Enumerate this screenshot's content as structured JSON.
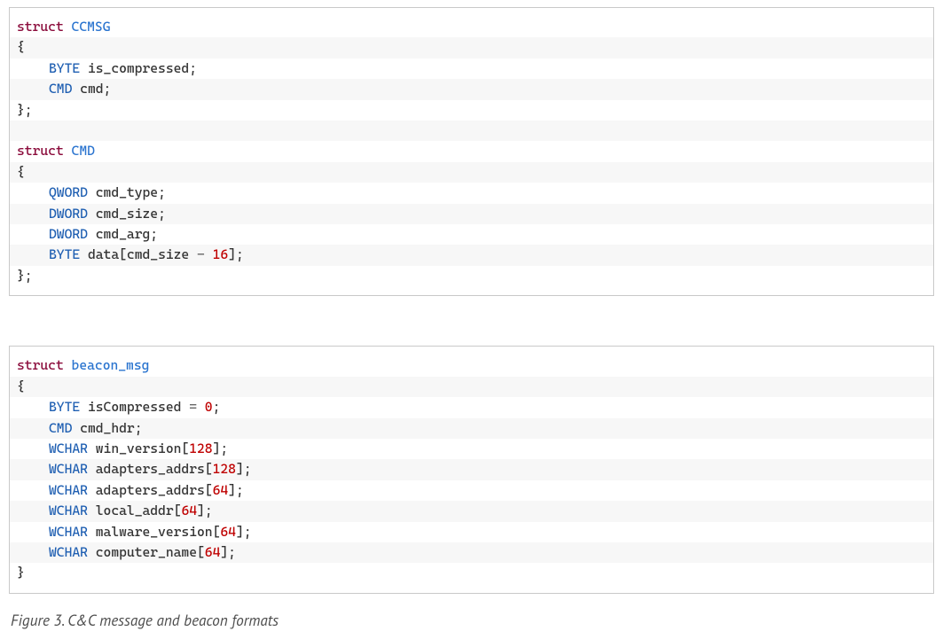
{
  "code1": {
    "lines": [
      {
        "stripe": false,
        "tokens": [
          {
            "cls": "kw",
            "t": "struct"
          },
          {
            "cls": "name",
            "t": " "
          },
          {
            "cls": "ident",
            "t": "CCMSG"
          }
        ]
      },
      {
        "stripe": true,
        "tokens": [
          {
            "cls": "punct",
            "t": "{"
          }
        ]
      },
      {
        "stripe": false,
        "indent": true,
        "tokens": [
          {
            "cls": "type",
            "t": "BYTE"
          },
          {
            "cls": "name",
            "t": " is_compressed"
          },
          {
            "cls": "punct",
            "t": ";"
          }
        ]
      },
      {
        "stripe": true,
        "indent": true,
        "tokens": [
          {
            "cls": "type",
            "t": "CMD"
          },
          {
            "cls": "name",
            "t": " cmd"
          },
          {
            "cls": "punct",
            "t": ";"
          }
        ]
      },
      {
        "stripe": false,
        "tokens": [
          {
            "cls": "punct",
            "t": "};"
          }
        ]
      },
      {
        "stripe": true,
        "tokens": [
          {
            "cls": "name",
            "t": " "
          }
        ]
      },
      {
        "stripe": false,
        "tokens": [
          {
            "cls": "kw",
            "t": "struct"
          },
          {
            "cls": "name",
            "t": " "
          },
          {
            "cls": "ident",
            "t": "CMD"
          }
        ]
      },
      {
        "stripe": true,
        "tokens": [
          {
            "cls": "punct",
            "t": "{"
          }
        ]
      },
      {
        "stripe": false,
        "indent": true,
        "tokens": [
          {
            "cls": "type",
            "t": "QWORD"
          },
          {
            "cls": "name",
            "t": " cmd_type"
          },
          {
            "cls": "punct",
            "t": ";"
          }
        ]
      },
      {
        "stripe": true,
        "indent": true,
        "tokens": [
          {
            "cls": "type",
            "t": "DWORD"
          },
          {
            "cls": "name",
            "t": " cmd_size"
          },
          {
            "cls": "punct",
            "t": ";"
          }
        ]
      },
      {
        "stripe": false,
        "indent": true,
        "tokens": [
          {
            "cls": "type",
            "t": "DWORD"
          },
          {
            "cls": "name",
            "t": " cmd_arg"
          },
          {
            "cls": "punct",
            "t": ";"
          }
        ]
      },
      {
        "stripe": true,
        "indent": true,
        "tokens": [
          {
            "cls": "type",
            "t": "BYTE"
          },
          {
            "cls": "name",
            "t": " data"
          },
          {
            "cls": "punct",
            "t": "["
          },
          {
            "cls": "name",
            "t": "cmd_size "
          },
          {
            "cls": "op",
            "t": "-"
          },
          {
            "cls": "name",
            "t": " "
          },
          {
            "cls": "num",
            "t": "16"
          },
          {
            "cls": "punct",
            "t": "]"
          },
          {
            "cls": "punct",
            "t": ";"
          }
        ]
      },
      {
        "stripe": false,
        "tokens": [
          {
            "cls": "punct",
            "t": "};"
          }
        ]
      }
    ]
  },
  "code2": {
    "lines": [
      {
        "stripe": false,
        "tokens": [
          {
            "cls": "kw",
            "t": "struct"
          },
          {
            "cls": "name",
            "t": " "
          },
          {
            "cls": "ident",
            "t": "beacon_msg"
          }
        ]
      },
      {
        "stripe": true,
        "tokens": [
          {
            "cls": "punct",
            "t": "{"
          }
        ]
      },
      {
        "stripe": false,
        "indent": true,
        "tokens": [
          {
            "cls": "type",
            "t": "BYTE"
          },
          {
            "cls": "name",
            "t": " isCompressed "
          },
          {
            "cls": "op",
            "t": "="
          },
          {
            "cls": "name",
            "t": " "
          },
          {
            "cls": "num",
            "t": "0"
          },
          {
            "cls": "punct",
            "t": ";"
          }
        ]
      },
      {
        "stripe": true,
        "indent": true,
        "tokens": [
          {
            "cls": "type",
            "t": "CMD"
          },
          {
            "cls": "name",
            "t": " cmd_hdr"
          },
          {
            "cls": "punct",
            "t": ";"
          }
        ]
      },
      {
        "stripe": false,
        "indent": true,
        "tokens": [
          {
            "cls": "type",
            "t": "WCHAR"
          },
          {
            "cls": "name",
            "t": " win_version"
          },
          {
            "cls": "punct",
            "t": "["
          },
          {
            "cls": "num",
            "t": "128"
          },
          {
            "cls": "punct",
            "t": "]"
          },
          {
            "cls": "punct",
            "t": ";"
          }
        ]
      },
      {
        "stripe": true,
        "indent": true,
        "tokens": [
          {
            "cls": "type",
            "t": "WCHAR"
          },
          {
            "cls": "name",
            "t": " adapters_addrs"
          },
          {
            "cls": "punct",
            "t": "["
          },
          {
            "cls": "num",
            "t": "128"
          },
          {
            "cls": "punct",
            "t": "]"
          },
          {
            "cls": "punct",
            "t": ";"
          }
        ]
      },
      {
        "stripe": false,
        "indent": true,
        "tokens": [
          {
            "cls": "type",
            "t": "WCHAR"
          },
          {
            "cls": "name",
            "t": " adapters_addrs"
          },
          {
            "cls": "punct",
            "t": "["
          },
          {
            "cls": "num",
            "t": "64"
          },
          {
            "cls": "punct",
            "t": "]"
          },
          {
            "cls": "punct",
            "t": ";"
          }
        ]
      },
      {
        "stripe": true,
        "indent": true,
        "tokens": [
          {
            "cls": "type",
            "t": "WCHAR"
          },
          {
            "cls": "name",
            "t": " local_addr"
          },
          {
            "cls": "punct",
            "t": "["
          },
          {
            "cls": "num",
            "t": "64"
          },
          {
            "cls": "punct",
            "t": "]"
          },
          {
            "cls": "punct",
            "t": ";"
          }
        ]
      },
      {
        "stripe": false,
        "indent": true,
        "tokens": [
          {
            "cls": "type",
            "t": "WCHAR"
          },
          {
            "cls": "name",
            "t": " malware_version"
          },
          {
            "cls": "punct",
            "t": "["
          },
          {
            "cls": "num",
            "t": "64"
          },
          {
            "cls": "punct",
            "t": "]"
          },
          {
            "cls": "punct",
            "t": ";"
          }
        ]
      },
      {
        "stripe": true,
        "indent": true,
        "tokens": [
          {
            "cls": "type",
            "t": "WCHAR"
          },
          {
            "cls": "name",
            "t": " computer_name"
          },
          {
            "cls": "punct",
            "t": "["
          },
          {
            "cls": "num",
            "t": "64"
          },
          {
            "cls": "punct",
            "t": "]"
          },
          {
            "cls": "punct",
            "t": ";"
          }
        ]
      },
      {
        "stripe": false,
        "tokens": [
          {
            "cls": "punct",
            "t": "}"
          }
        ]
      }
    ]
  },
  "caption": "Figure 3. C&C message and beacon formats"
}
